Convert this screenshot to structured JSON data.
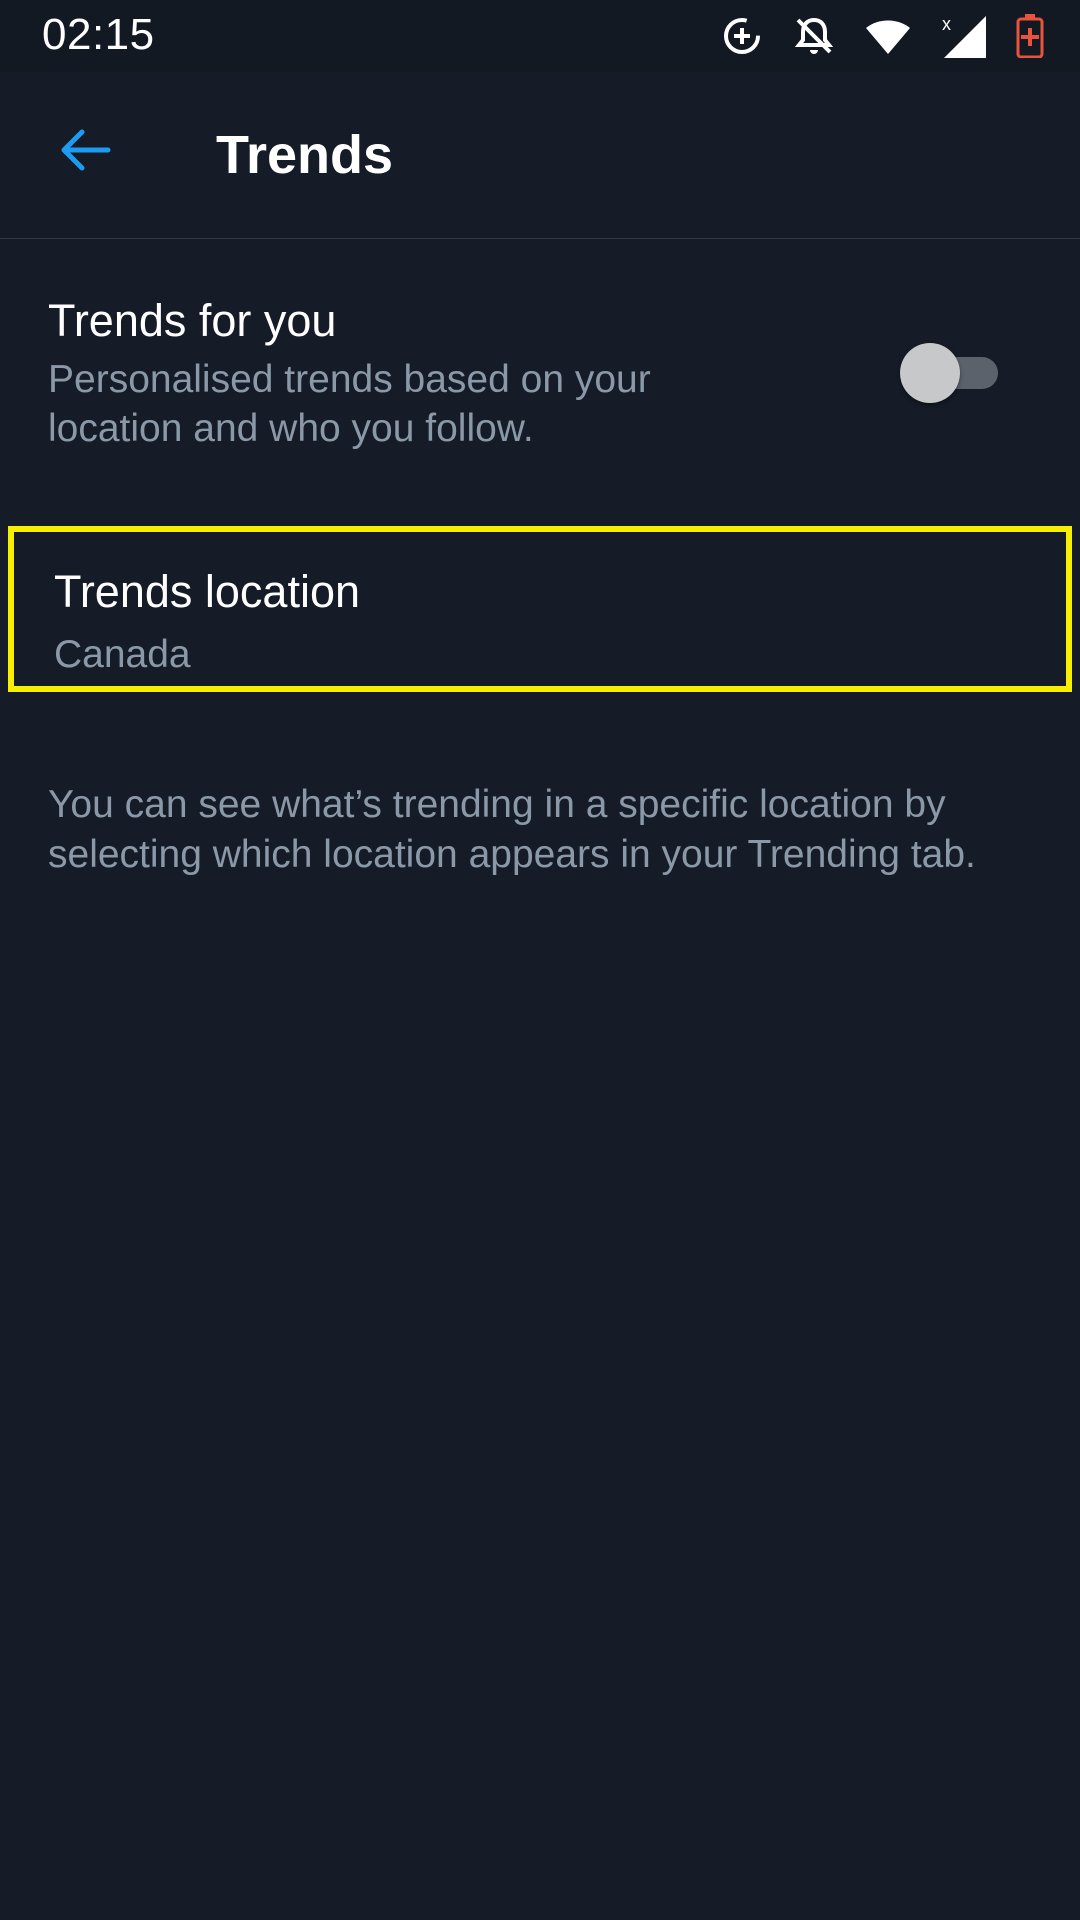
{
  "status_bar": {
    "time": "02:15",
    "icons": [
      "data-saver-icon",
      "notifications-off-icon",
      "wifi-icon",
      "cellular-signal-icon",
      "battery-charging-icon"
    ]
  },
  "app_bar": {
    "back_icon": "arrow-left-icon",
    "title": "Trends"
  },
  "settings": {
    "trends_for_you": {
      "title": "Trends for you",
      "subtitle": "Personalised trends based on your location and who you follow.",
      "toggle_on": false
    },
    "trends_location": {
      "title": "Trends location",
      "value": "Canada"
    },
    "help_text": "You can see what’s trending in a specific location by selecting which location appears in your Trending tab."
  },
  "colors": {
    "background": "#151c27",
    "status_bar": "#121923",
    "accent_blue": "#1d9bf0",
    "secondary_text": "#8a98a7",
    "highlight": "#f8ef00",
    "battery_red": "#e8533b"
  }
}
